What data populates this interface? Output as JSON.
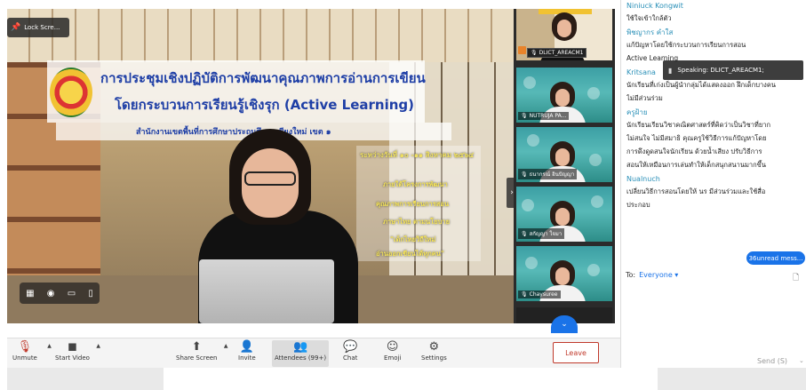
{
  "video": {
    "lock_label": "Lock Scre...",
    "title_line1": "การประชุมเชิงปฏิบัติการพัฒนาคุณภาพการอ่านการเขียน",
    "title_line2": "โดยกระบวนการเรียนรู้เชิงรุก (Active Learning)",
    "subtitle": "สำนักงานเขตพื้นที่การศึกษาประถมศึกษาเชียงใหม่ เขต ๑",
    "date": "ระหว่างวันที่ ๑๐ -๑๑ สิงหาคม ๒๕๖๔",
    "project_lines": [
      "ภายใต้โครงการพัฒนา",
      "คุณภาพการเรียนการสอน",
      "ภาษาไทย ตามนโยบาย",
      "\"เด็กไทยวิถีใหม่",
      "อ่านออกเขียนได้ทุกคน\""
    ]
  },
  "gallery": {
    "tiles": [
      {
        "name": "DLICT_AREACM1"
      },
      {
        "name": "NUTRUJA PA..."
      },
      {
        "name": "ธนากรณ์ อินปัญญา"
      },
      {
        "name": "สกัญญา ใจมา"
      },
      {
        "name": "Chaysuree"
      }
    ]
  },
  "toolbar": {
    "unmute": "Unmute",
    "start_video": "Start Video",
    "share_screen": "Share Screen",
    "invite": "Invite",
    "attendees": "Attendees (99+)",
    "chat": "Chat",
    "emoji": "Emoji",
    "settings": "Settings",
    "leave": "Leave"
  },
  "chat": {
    "speaking": "Speaking: DLICT_AREACM1;",
    "messages": [
      {
        "sender": "Niniuck Kongwit",
        "lines": [
          "ใช้ใจเข้าใกล้ตัว"
        ]
      },
      {
        "sender": "พิชญากร คำใส",
        "lines": [
          "แก้ปัญหาโดยใช้กระบวนการเรียนการสอน",
          "Active Learning"
        ]
      },
      {
        "sender": "Kritsana",
        "lines": [
          "นักเรียนที่เก่งเป็นผู้นำกลุ่มได้แสดงออก ฝึกเด็กบางคน",
          "ไม่มีส่วนร่วม"
        ]
      },
      {
        "sender": "ครูฝ้าย",
        "lines": [
          "นักเรียนเรียนวิชาคณิตศาสตร์ที่คิดว่าเป็นวิชาที่ยาก",
          "ไม่สนใจ ไม่มีสมาธิ  คุณครูใช้วิธีการแก้ปัญหาโดย",
          "การดึงดูดสนใจนักเรียน ด้วยน้ำเสียง ปรับวิธีการ",
          "สอนให้เหมือนการเล่นทำให้เด็กสนุกสนานมากขึ้น"
        ]
      },
      {
        "sender": "Nualnuch",
        "lines": [
          "เปลี่ยนวิธีการสอนโดยให้ นร มีส่วนร่วมและใช้สื่อ",
          "ประกอบ"
        ]
      }
    ],
    "unread": "36unread mess...",
    "to_label": "To:",
    "to_target": "Everyone ▾",
    "send": "Send (S)"
  },
  "colors": {
    "accent": "#1a73e8",
    "leave": "#c0392b",
    "sender": "#2a90b8"
  }
}
